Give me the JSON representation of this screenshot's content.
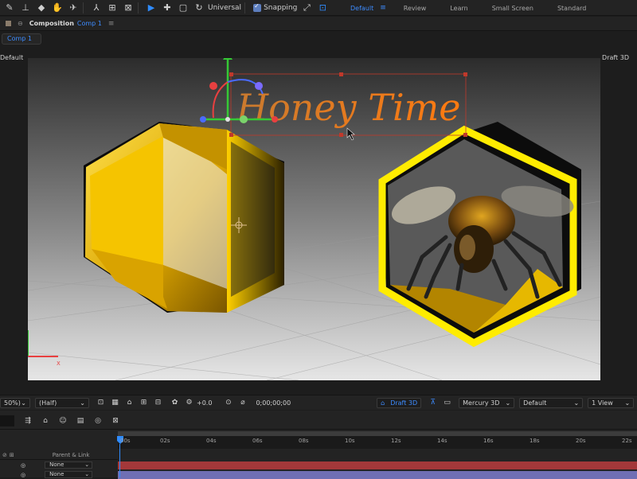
{
  "toolbar": {
    "universal_label": "Universal",
    "snapping_label": "Snapping",
    "icons": [
      "brush-icon",
      "stamp-icon",
      "eraser-icon",
      "roto-brush-icon",
      "puppet-pin-icon",
      "axis-local-icon",
      "axis-world-icon",
      "axis-view-icon",
      "selection-tool-icon",
      "hand-tool-icon",
      "zoom-tool-icon",
      "rotate-tool-icon",
      "snap-icon",
      "expand-icon"
    ]
  },
  "workspaces": {
    "items": [
      "Default",
      "Review",
      "Learn",
      "Small Screen",
      "Standard"
    ],
    "active": "Default"
  },
  "panel": {
    "title": "Composition",
    "comp_name": "Comp 1",
    "tab": "Comp 1",
    "view_left": "Default",
    "view_right": "Draft 3D"
  },
  "scene": {
    "title_text": "Honey Time",
    "accent_color": "#ffd400",
    "text_gradient_start": "#c97a2f",
    "text_gradient_end": "#ff7a10"
  },
  "viewer_bar": {
    "zoom": "50%)",
    "resolution": "(Half)",
    "exposure": "+0.0",
    "timecode": "0;00;00;00",
    "draft3d_label": "Draft 3D",
    "renderer": "Mercury 3D",
    "view_mode": "Default",
    "views": "1 View"
  },
  "timeline": {
    "ticks": [
      "00s",
      "02s",
      "04s",
      "06s",
      "08s",
      "10s",
      "12s",
      "14s",
      "16s",
      "18s",
      "20s",
      "22s"
    ],
    "column_header": "Parent & Link",
    "layers": [
      {
        "parent": "None",
        "color": "#a3383a"
      },
      {
        "parent": "None",
        "color": "#6f6fb4"
      }
    ]
  }
}
